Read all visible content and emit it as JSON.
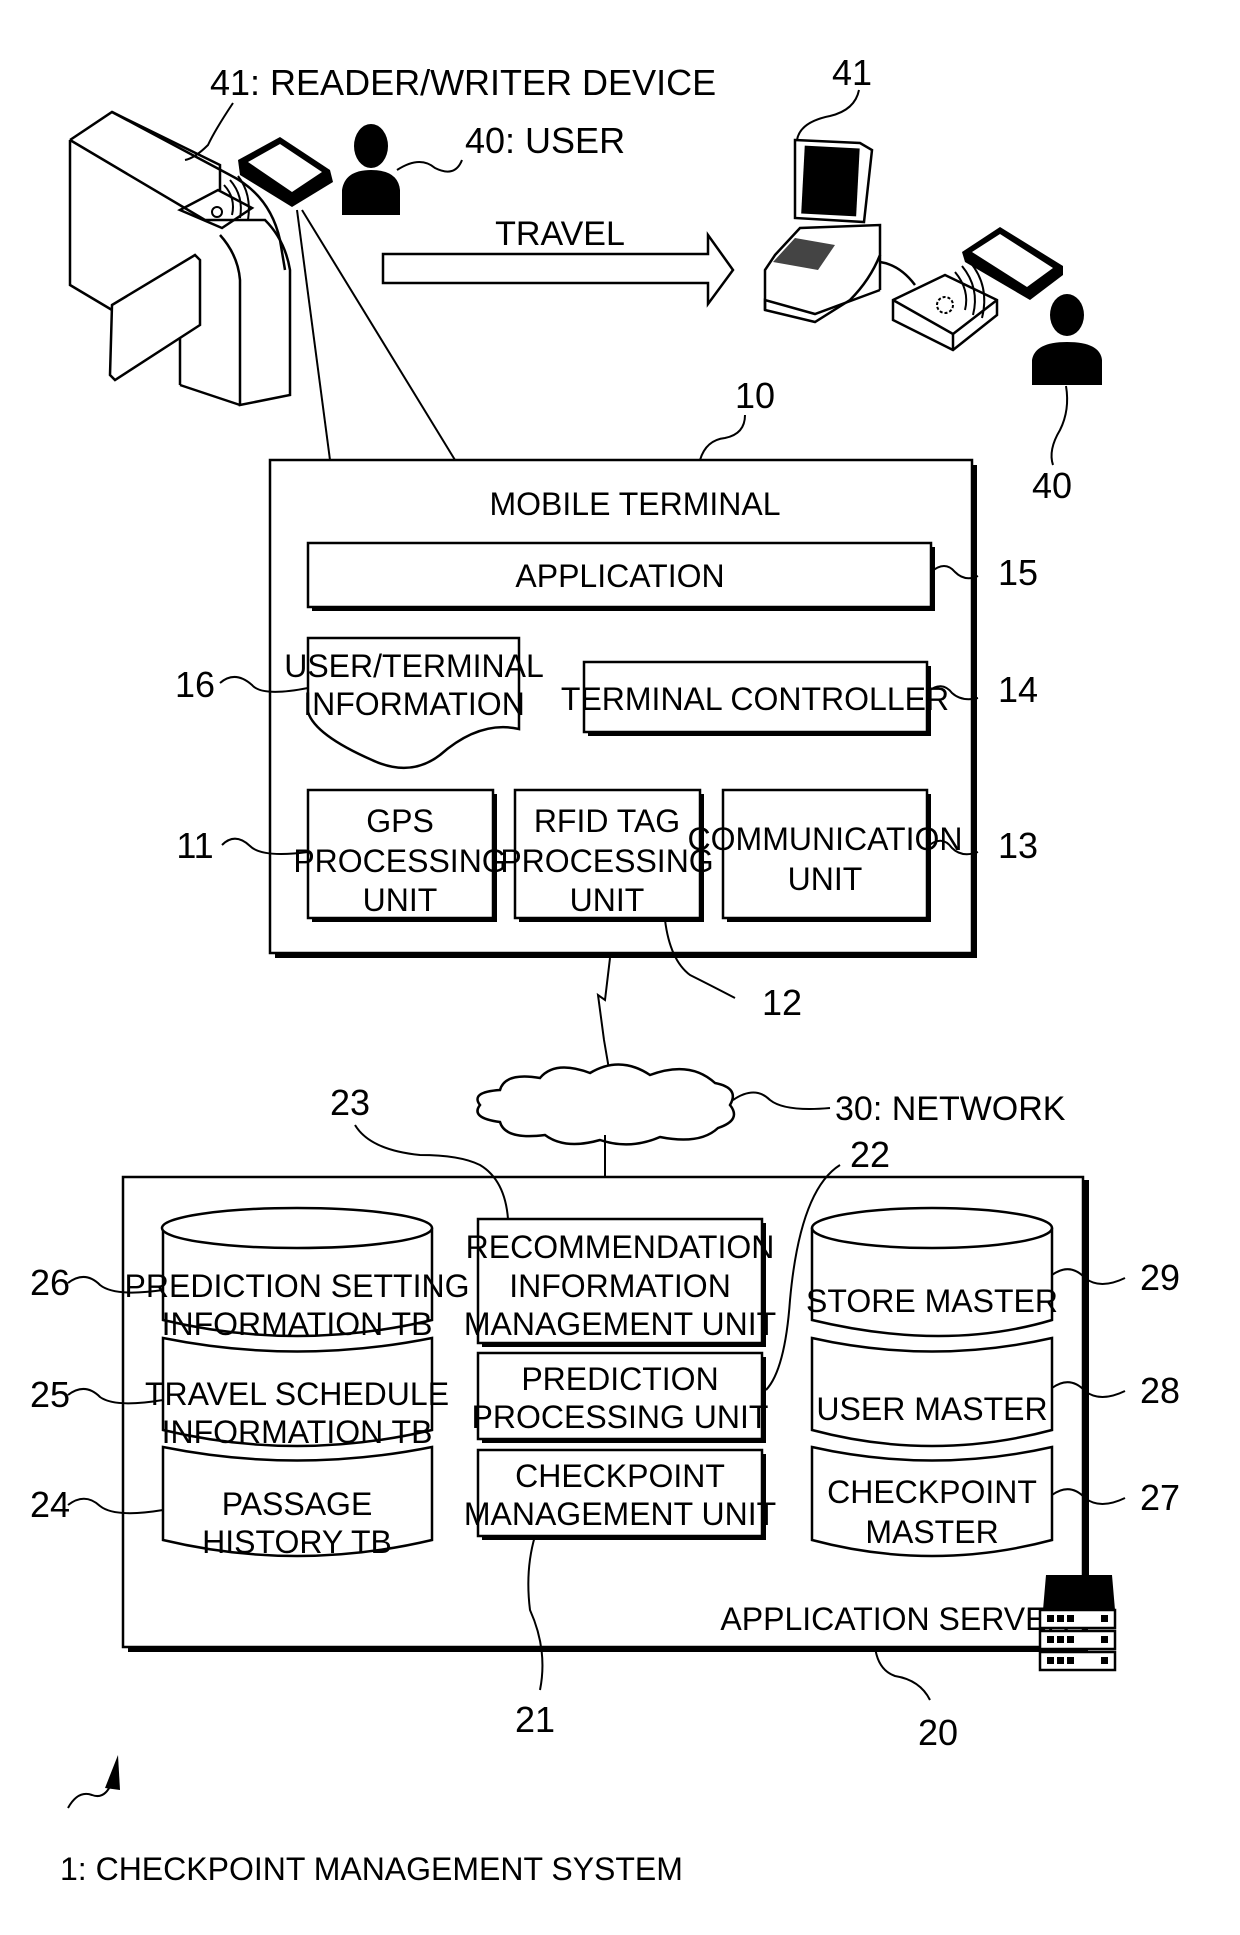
{
  "figure": {
    "system_label": "1: CHECKPOINT MANAGEMENT SYSTEM"
  },
  "top": {
    "reader_writer_label": "41: READER/WRITER DEVICE",
    "user_label": "40: USER",
    "travel_label": "TRAVEL",
    "pos_ref": "41",
    "user_ref": "40"
  },
  "mobile_terminal": {
    "ref": "10",
    "title": "MOBILE TERMINAL",
    "application": {
      "label": "APPLICATION",
      "ref": "15"
    },
    "user_terminal_info": {
      "lines": [
        "USER/TERMINAL",
        "INFORMATION"
      ],
      "ref": "16"
    },
    "terminal_controller": {
      "label": "TERMINAL CONTROLLER",
      "ref": "14"
    },
    "gps": {
      "lines": [
        "GPS",
        "PROCESSING",
        "UNIT"
      ],
      "ref": "11"
    },
    "rfid": {
      "lines": [
        "RFID TAG",
        "PROCESSING",
        "UNIT"
      ],
      "ref": "12"
    },
    "communication": {
      "lines": [
        "COMMUNICATION",
        "UNIT"
      ],
      "ref": "13"
    }
  },
  "network": {
    "label": "30: NETWORK"
  },
  "application_server": {
    "ref": "20",
    "title": "APPLICATION SERVER",
    "units": [
      {
        "lines": [
          "RECOMMENDATION",
          "INFORMATION",
          "MANAGEMENT UNIT"
        ],
        "ref": "23"
      },
      {
        "lines": [
          "PREDICTION",
          "PROCESSING UNIT"
        ],
        "ref": "22"
      },
      {
        "lines": [
          "CHECKPOINT",
          "MANAGEMENT UNIT"
        ],
        "ref": "21"
      }
    ],
    "left_db": [
      {
        "lines": [
          "PREDICTION SETTING",
          "INFORMATION TB"
        ],
        "ref": "26"
      },
      {
        "lines": [
          "TRAVEL SCHEDULE",
          "INFORMATION TB"
        ],
        "ref": "25"
      },
      {
        "lines": [
          "PASSAGE",
          "HISTORY TB"
        ],
        "ref": "24"
      }
    ],
    "right_db": [
      {
        "lines": [
          "STORE MASTER"
        ],
        "ref": "29"
      },
      {
        "lines": [
          "USER MASTER"
        ],
        "ref": "28"
      },
      {
        "lines": [
          "CHECKPOINT",
          "MASTER"
        ],
        "ref": "27"
      }
    ]
  }
}
